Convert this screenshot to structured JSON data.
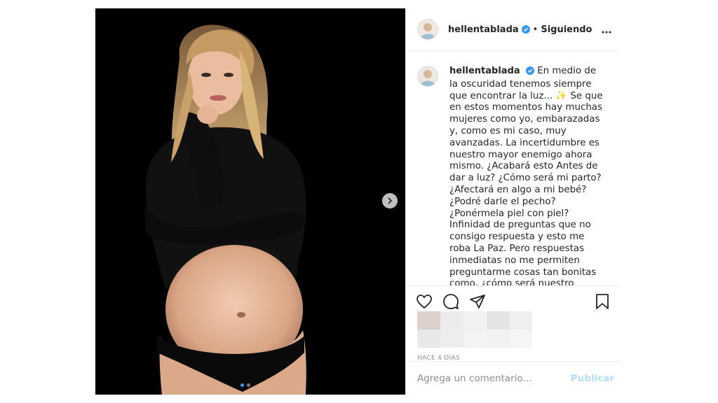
{
  "post": {
    "username": "hellentablada",
    "follow_status": "Siguiendo",
    "caption": "En medio de la oscuridad tenemos siempre que encontrar la luz... ✨ Se que en estos momentos hay muchas mujeres como yo, embarazadas y, como es mi caso, muy avanzadas. La incertidumbre es nuestro mayor enemigo ahora mismo. ¿Acabará esto Antes de dar a luz? ¿Cómo será mi parto? ¿Afectará en algo a mi bebé? ¿Podré darle el pecho? ¿Ponérmela piel con piel? Infinidad de preguntas que no consigo respuesta y esto me roba La Paz. Pero respuestas inmediatas no me permiten preguntarme cosas tan bonitas como, ¿cómo será nuestro encuentro? ¿A quien se parecerá? Solo se que confío a ciegas en el",
    "date": "HACE 4 DÍAS",
    "comment_placeholder": "Agrega un comentario...",
    "publish_label": "Publicar",
    "carousel_index": 1,
    "carousel_total": 2
  },
  "icons": {
    "verified": "verified-badge",
    "more": "more-icon",
    "like": "heart-icon",
    "comment": "comment-icon",
    "share": "share-icon",
    "save": "bookmark-icon",
    "next": "chevron-right-icon"
  },
  "colors": {
    "verified_blue": "#3897f0",
    "publish_disabled": "#b2dffc",
    "text": "#262626",
    "muted": "#8e8e8e"
  }
}
